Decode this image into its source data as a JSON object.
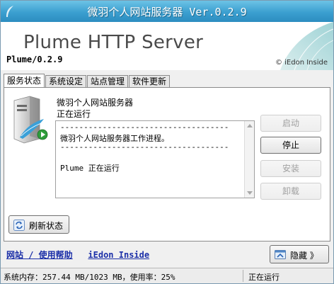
{
  "window": {
    "title": "微羽个人网站服务器 Ver.0.2.9"
  },
  "banner": {
    "title": "Plume HTTP Server",
    "version": "Plume/0.2.9",
    "credit": "© iEdon Inside"
  },
  "tabs": [
    {
      "label": "服务状态",
      "active": true
    },
    {
      "label": "系统设定",
      "active": false
    },
    {
      "label": "站点管理",
      "active": false
    },
    {
      "label": "软件更新",
      "active": false
    }
  ],
  "service": {
    "name": "微羽个人网站服务器",
    "status": "正在运行"
  },
  "log": {
    "lines": [
      "------------------------------------",
      "微羽个人网站服务器工作进程。",
      "------------------------------------",
      "",
      "Plume 正在运行"
    ]
  },
  "buttons": {
    "start": {
      "label": "启动",
      "enabled": false
    },
    "stop": {
      "label": "停止",
      "enabled": true
    },
    "install": {
      "label": "安装",
      "enabled": false
    },
    "uninstall": {
      "label": "卸载",
      "enabled": false
    }
  },
  "refresh": {
    "label": "刷新状态"
  },
  "footer": {
    "link1": "网站 / 使用帮助",
    "link2": "iEdon Inside",
    "hide_label": "隐藏 》"
  },
  "statusbar": {
    "memory": "系统内存：257.44 MB/1023 MB，使用率：25%",
    "state": "正在运行"
  },
  "colors": {
    "titlebar": "#3b9fd0",
    "link": "#1b2fa8"
  },
  "icons": {
    "server": "server-icon",
    "refresh": "refresh-icon",
    "hide": "hide-icon"
  }
}
